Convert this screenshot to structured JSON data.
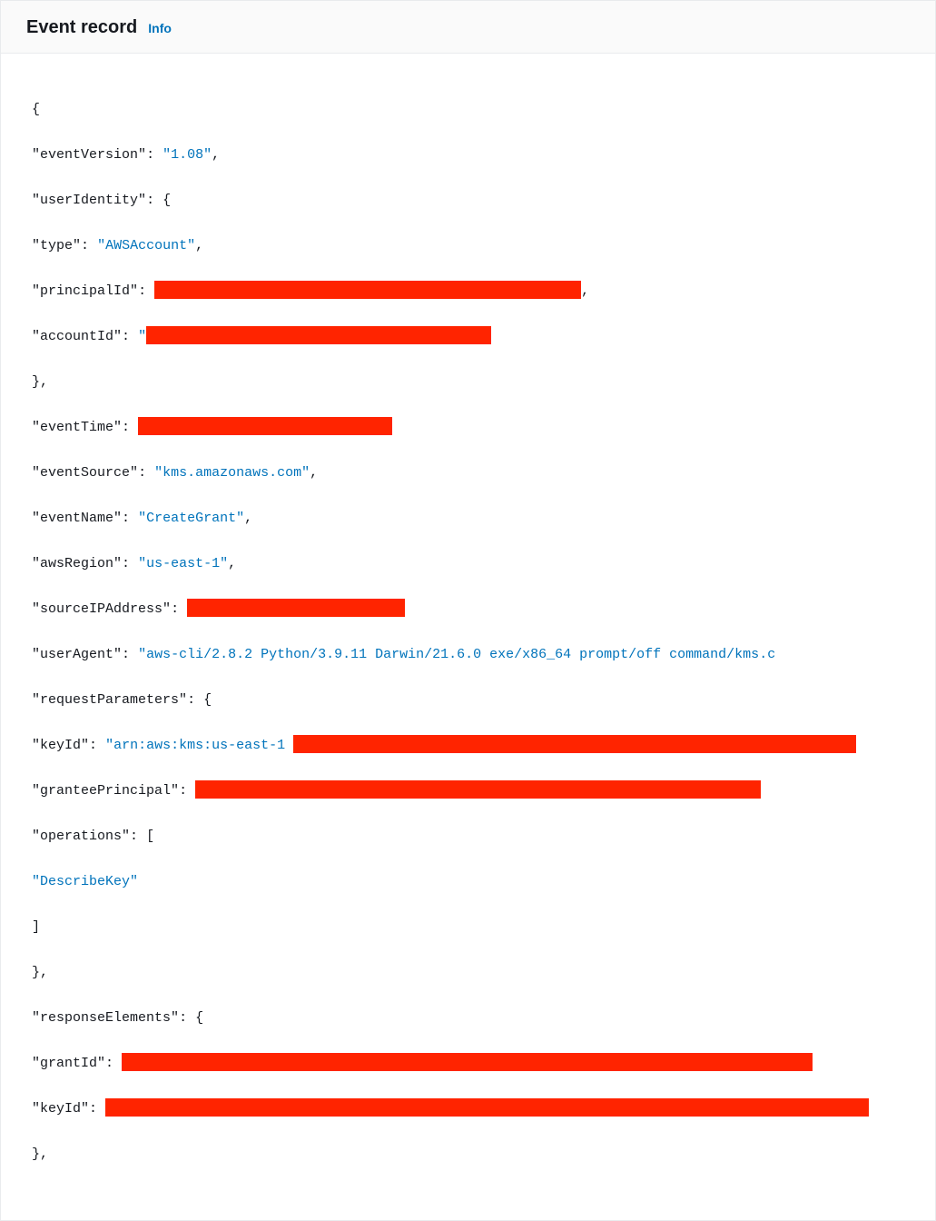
{
  "header": {
    "title": "Event record",
    "info_label": "Info"
  },
  "event": {
    "open_brace": "{",
    "close_brace": "}",
    "comma": ",",
    "colon": ": ",
    "open_bracket": "[",
    "close_bracket": "]",
    "q": "\"",
    "eventVersion_key": "eventVersion",
    "eventVersion_val": "1.08",
    "userIdentity_key": "userIdentity",
    "type_key": "type",
    "type_val": "AWSAccount",
    "principalId_key": "principalId",
    "accountId_key": "accountId",
    "eventTime_key": "eventTime",
    "eventSource_key": "eventSource",
    "eventSource_val": "kms.amazonaws.com",
    "eventName_key": "eventName",
    "eventName_val": "CreateGrant",
    "awsRegion_key": "awsRegion",
    "awsRegion_val": "us-east-1",
    "sourceIPAddress_key": "sourceIPAddress",
    "userAgent_key": "userAgent",
    "userAgent_val": "aws-cli/2.8.2 Python/3.9.11 Darwin/21.6.0 exe/x86_64 prompt/off command/kms.c",
    "requestParameters_key": "requestParameters",
    "keyId_key": "keyId",
    "keyId_val_prefix": "arn:aws:kms:us-east-1",
    "granteePrincipal_key": "granteePrincipal",
    "operations_key": "operations",
    "operations_val0": "DescribeKey",
    "responseElements_key": "responseElements",
    "grantId_key": "grantId"
  }
}
